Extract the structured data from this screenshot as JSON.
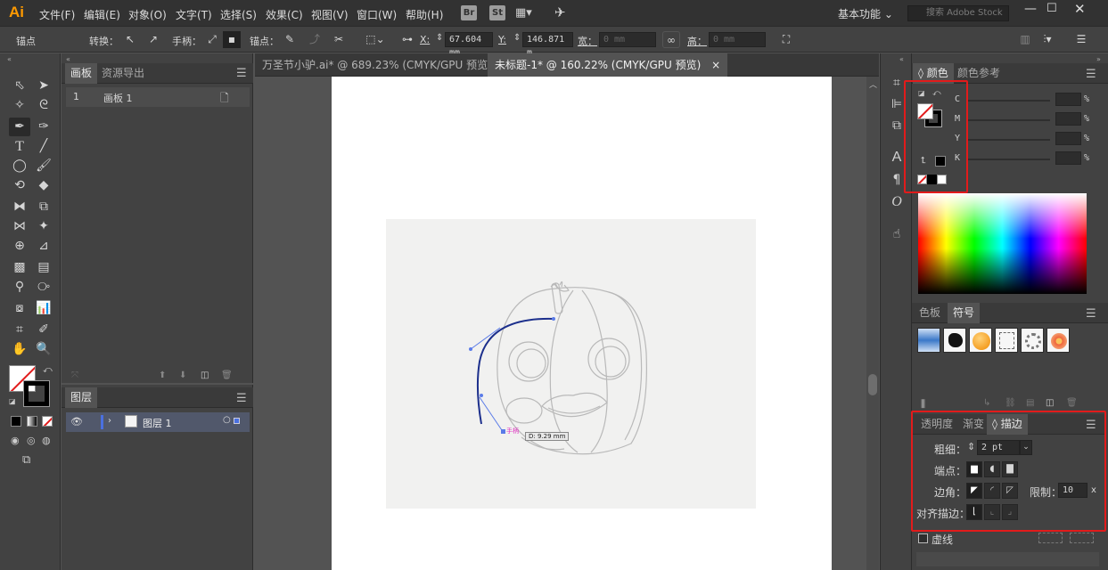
{
  "app": {
    "logo": "Ai",
    "workspace": "基本功能",
    "search_placeholder": "搜索 Adobe Stock"
  },
  "menu": [
    "文件(F)",
    "编辑(E)",
    "对象(O)",
    "文字(T)",
    "选择(S)",
    "效果(C)",
    "视图(V)",
    "窗口(W)",
    "帮助(H)"
  ],
  "app_icons": [
    "Br",
    "St"
  ],
  "control": {
    "anchor_label": "锚点",
    "convert_label": "转换：",
    "handle_label": "手柄：",
    "anchor_pts_label": "锚点：",
    "x_label": "X:",
    "x_value": "67.604 mm",
    "y_label": "Y:",
    "y_value": "146.871 m",
    "w_label": "宽：",
    "w_value": "0 mm",
    "h_label": "高：",
    "h_value": "0 mm"
  },
  "artboards_panel": {
    "tabs": [
      "画板",
      "资源导出"
    ],
    "rows": [
      {
        "num": "1",
        "name": "画板 1"
      }
    ]
  },
  "layers_panel": {
    "tab": "图层",
    "rows": [
      {
        "name": "图层 1"
      }
    ]
  },
  "doc_tabs": [
    {
      "label": "万圣节小驴.ai* @ 689.23% (CMYK/GPU 预览)",
      "close": "×"
    },
    {
      "label": "未标题-1* @ 160.22% (CMYK/GPU 预览)",
      "close": "×"
    }
  ],
  "canvas": {
    "handle_label": "手柄",
    "distance_label": "D: 9.29 mm"
  },
  "color_panel": {
    "tabs": [
      "颜色",
      "颜色参考"
    ],
    "channels": [
      "C",
      "M",
      "Y",
      "K"
    ],
    "pct": "%"
  },
  "swatch_panel": {
    "tabs": [
      "色板",
      "符号"
    ]
  },
  "stroke_panel": {
    "tabs": [
      "透明度",
      "渐变",
      "描边"
    ],
    "weight_label": "粗细：",
    "weight_value": "2 pt",
    "cap_label": "端点：",
    "corner_label": "边角：",
    "limit_label": "限制：",
    "limit_value": "10",
    "limit_unit": "x",
    "align_label": "对齐描边：",
    "dashed_label": "虚线"
  },
  "colors": {
    "accent": "#e21b1b",
    "brand": "#ff9a00",
    "path": "#1c2f8c"
  }
}
